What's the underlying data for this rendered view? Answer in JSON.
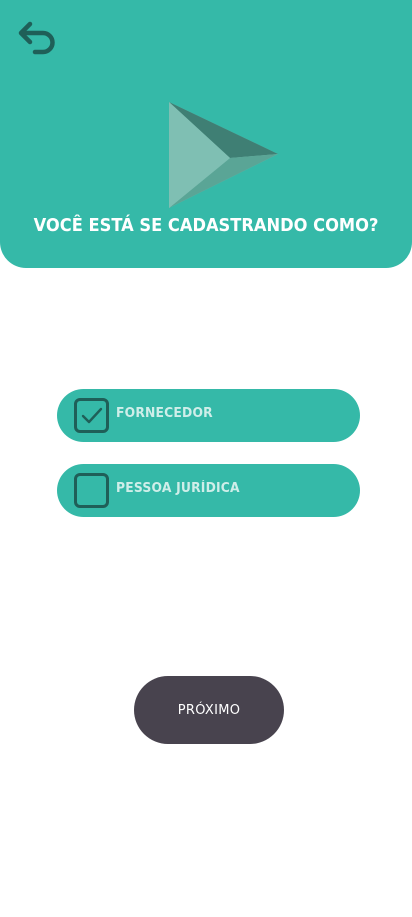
{
  "header": {
    "title": "VOCÊ ESTÁ SE CADASTRANDO COMO?",
    "background_color": "#35b9a8",
    "back_icon": "undo-arrow-icon",
    "logo_icon": "play-triangle-logo"
  },
  "options": [
    {
      "label": "FORNECEDOR",
      "checked": true
    },
    {
      "label": "PESSOA JURÍDICA",
      "checked": false
    }
  ],
  "actions": {
    "next_label": "PRÓXIMO",
    "next_color": "#48434e"
  },
  "colors": {
    "accent": "#35b9a8",
    "checkbox_border": "#1f5f58"
  }
}
